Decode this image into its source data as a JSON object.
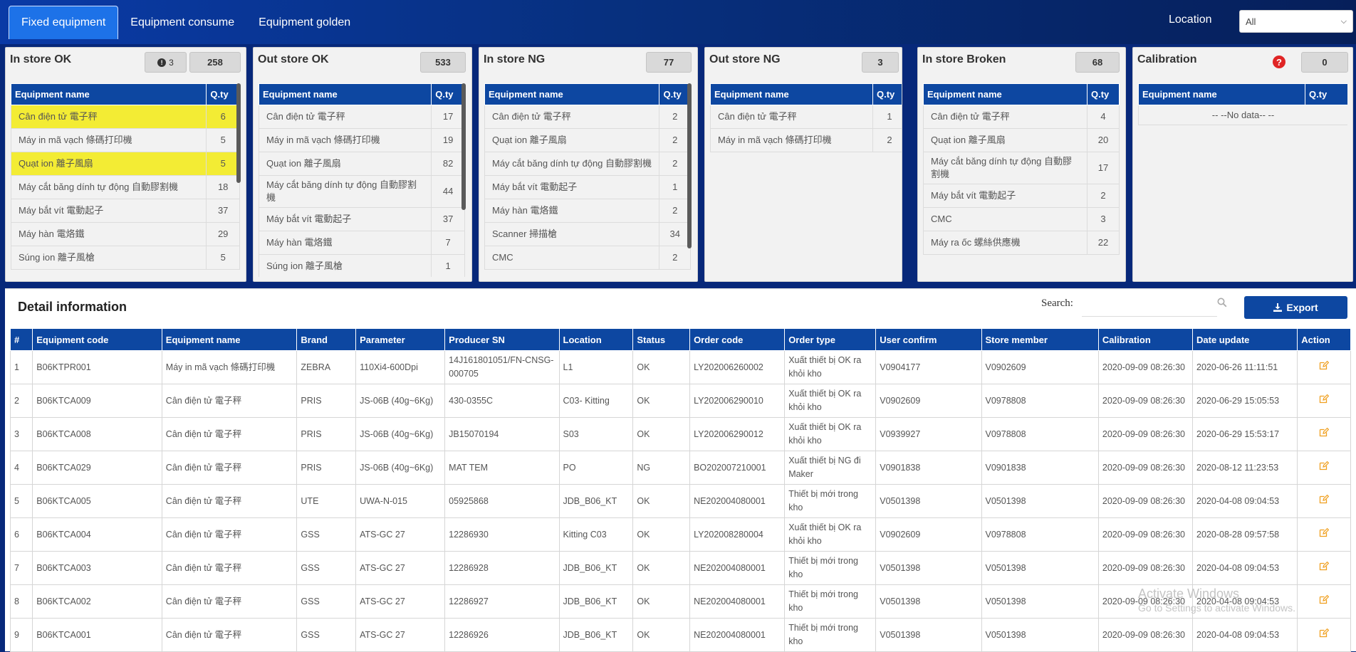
{
  "nav": {
    "tabs": [
      {
        "label": "Fixed equipment",
        "active": true
      },
      {
        "label": "Equipment consume",
        "active": false
      },
      {
        "label": "Equipment golden",
        "active": false
      }
    ],
    "location_label": "Location",
    "location_value": "All"
  },
  "panels": {
    "in_store_ok": {
      "title": "In store OK",
      "warn_count": "3",
      "count": "258",
      "col_name": "Equipment name",
      "col_qty": "Q.ty",
      "rows": [
        {
          "name": "Cân điện tử 電子秤",
          "qty": "6"
        },
        {
          "name": "Máy in mã vạch 條碼打印機",
          "qty": "5"
        },
        {
          "name": "Quạt ion 離子風扇",
          "qty": "5"
        },
        {
          "name": "Máy cắt băng dính tự động 自動膠割機",
          "qty": "18"
        },
        {
          "name": "Máy bắt vít 電動起子",
          "qty": "37"
        },
        {
          "name": "Máy hàn 電烙鐵",
          "qty": "29"
        },
        {
          "name": "Súng ion 離子風槍",
          "qty": "5"
        }
      ],
      "highlight_rows": [
        0,
        2
      ],
      "highlight_color": "#f3ec34"
    },
    "out_store_ok": {
      "title": "Out store OK",
      "count": "533",
      "col_name": "Equipment name",
      "col_qty": "Q.ty",
      "rows": [
        {
          "name": "Cân điện tử 電子秤",
          "qty": "17"
        },
        {
          "name": "Máy in mã vạch 條碼打印機",
          "qty": "19"
        },
        {
          "name": "Quạt ion 離子風扇",
          "qty": "82"
        },
        {
          "name": "Máy cắt băng dính tự động 自動膠割機",
          "qty": "44"
        },
        {
          "name": "Máy bắt vít 電動起子",
          "qty": "37"
        },
        {
          "name": "Máy hàn 電烙鐵",
          "qty": "7"
        },
        {
          "name": "Súng ion 離子風槍",
          "qty": "1"
        }
      ]
    },
    "in_store_ng": {
      "title": "In store NG",
      "count": "77",
      "col_name": "Equipment name",
      "col_qty": "Q.ty",
      "rows": [
        {
          "name": "Cân điện tử 電子秤",
          "qty": "2"
        },
        {
          "name": "Quạt ion 離子風扇",
          "qty": "2"
        },
        {
          "name": "Máy cắt băng dính tự động 自動膠割機",
          "qty": "2"
        },
        {
          "name": "Máy bắt vít 電動起子",
          "qty": "1"
        },
        {
          "name": "Máy hàn 電烙鐵",
          "qty": "2"
        },
        {
          "name": "Scanner 掃描槍",
          "qty": "34"
        },
        {
          "name": "CMC",
          "qty": "2"
        }
      ]
    },
    "out_store_ng": {
      "title": "Out store NG",
      "count": "3",
      "col_name": "Equipment name",
      "col_qty": "Q.ty",
      "rows": [
        {
          "name": "Cân điện tử 電子秤",
          "qty": "1"
        },
        {
          "name": "Máy in mã vạch 條碼打印機",
          "qty": "2"
        }
      ]
    },
    "in_store_broken": {
      "title": "In store Broken",
      "count": "68",
      "col_name": "Equipment name",
      "col_qty": "Q.ty",
      "rows": [
        {
          "name": "Cân điện tử 電子秤",
          "qty": "4"
        },
        {
          "name": "Quạt ion 離子風扇",
          "qty": "20"
        },
        {
          "name": "Máy cắt băng dính tự động 自動膠割機",
          "qty": "17"
        },
        {
          "name": "Máy bắt vít 電動起子",
          "qty": "2"
        },
        {
          "name": "CMC",
          "qty": "3"
        },
        {
          "name": "Máy ra ốc 螺絲供應機",
          "qty": "22"
        }
      ]
    },
    "calibration": {
      "title": "Calibration",
      "alert_icon": "?",
      "count": "0",
      "col_name": "Equipment name",
      "col_qty": "Q.ty",
      "no_data": "-- --No data-- --"
    }
  },
  "detail": {
    "title": "Detail information",
    "search_label": "Search:",
    "search_value": "",
    "export_label": "Export",
    "columns": [
      "#",
      "Equipment code",
      "Equipment name",
      "Brand",
      "Parameter",
      "Producer SN",
      "Location",
      "Status",
      "Order code",
      "Order type",
      "User confirm",
      "Store member",
      "Calibration",
      "Date update",
      "Action"
    ],
    "rows": [
      {
        "no": "1",
        "code": "B06KTPR001",
        "name": "Máy in mã vạch 條碼打印機",
        "brand": "ZEBRA",
        "param": "110Xi4-600Dpi",
        "sn": "14J161801051/FN-CNSG-000705",
        "location": "L1",
        "status": "OK",
        "order_code": "LY202006260002",
        "order_type": "Xuất thiết bị OK ra khỏi kho",
        "user_confirm": "V0904177",
        "store_member": "V0902609",
        "calibration": "2020-09-09 08:26:30",
        "date_update": "2020-06-26 11:11:51"
      },
      {
        "no": "2",
        "code": "B06KTCA009",
        "name": "Cân điện tử 電子秤",
        "brand": "PRIS",
        "param": "JS-06B (40g~6Kg)",
        "sn": "430-0355C",
        "location": "C03- Kitting",
        "status": "OK",
        "order_code": "LY202006290010",
        "order_type": "Xuất thiết bị OK ra khỏi kho",
        "user_confirm": "V0902609",
        "store_member": "V0978808",
        "calibration": "2020-09-09 08:26:30",
        "date_update": "2020-06-29 15:05:53"
      },
      {
        "no": "3",
        "code": "B06KTCA008",
        "name": "Cân điện tử 電子秤",
        "brand": "PRIS",
        "param": "JS-06B (40g~6Kg)",
        "sn": "JB15070194",
        "location": "S03",
        "status": "OK",
        "order_code": "LY202006290012",
        "order_type": "Xuất thiết bị OK ra khỏi kho",
        "user_confirm": "V0939927",
        "store_member": "V0978808",
        "calibration": "2020-09-09 08:26:30",
        "date_update": "2020-06-29 15:53:17"
      },
      {
        "no": "4",
        "code": "B06KTCA029",
        "name": "Cân điện tử 電子秤",
        "brand": "PRIS",
        "param": "JS-06B (40g~6Kg)",
        "sn": "MAT TEM",
        "location": "PO",
        "status": "NG",
        "order_code": "BO202007210001",
        "order_type": "Xuất thiết bị NG đi Maker",
        "user_confirm": "V0901838",
        "store_member": "V0901838",
        "calibration": "2020-09-09 08:26:30",
        "date_update": "2020-08-12 11:23:53"
      },
      {
        "no": "5",
        "code": "B06KTCA005",
        "name": "Cân điện tử 電子秤",
        "brand": "UTE",
        "param": "UWA-N-015",
        "sn": "05925868",
        "location": "JDB_B06_KT",
        "status": "OK",
        "order_code": "NE202004080001",
        "order_type": "Thiết bị mới trong kho",
        "user_confirm": "V0501398",
        "store_member": "V0501398",
        "calibration": "2020-09-09 08:26:30",
        "date_update": "2020-04-08 09:04:53"
      },
      {
        "no": "6",
        "code": "B06KTCA004",
        "name": "Cân điện tử 電子秤",
        "brand": "GSS",
        "param": "ATS-GC 27",
        "sn": "12286930",
        "location": "Kitting C03",
        "status": "OK",
        "order_code": "LY202008280004",
        "order_type": "Xuất thiết bị OK ra khỏi kho",
        "user_confirm": "V0902609",
        "store_member": "V0978808",
        "calibration": "2020-09-09 08:26:30",
        "date_update": "2020-08-28 09:57:58"
      },
      {
        "no": "7",
        "code": "B06KTCA003",
        "name": "Cân điện tử 電子秤",
        "brand": "GSS",
        "param": "ATS-GC 27",
        "sn": "12286928",
        "location": "JDB_B06_KT",
        "status": "OK",
        "order_code": "NE202004080001",
        "order_type": "Thiết bị mới trong kho",
        "user_confirm": "V0501398",
        "store_member": "V0501398",
        "calibration": "2020-09-09 08:26:30",
        "date_update": "2020-04-08 09:04:53"
      },
      {
        "no": "8",
        "code": "B06KTCA002",
        "name": "Cân điện tử 電子秤",
        "brand": "GSS",
        "param": "ATS-GC 27",
        "sn": "12286927",
        "location": "JDB_B06_KT",
        "status": "OK",
        "order_code": "NE202004080001",
        "order_type": "Thiết bị mới trong kho",
        "user_confirm": "V0501398",
        "store_member": "V0501398",
        "calibration": "2020-09-09 08:26:30",
        "date_update": "2020-04-08 09:04:53"
      },
      {
        "no": "9",
        "code": "B06KTCA001",
        "name": "Cân điện tử 電子秤",
        "brand": "GSS",
        "param": "ATS-GC 27",
        "sn": "12286926",
        "location": "JDB_B06_KT",
        "status": "OK",
        "order_code": "NE202004080001",
        "order_type": "Thiết bị mới trong kho",
        "user_confirm": "V0501398",
        "store_member": "V0501398",
        "calibration": "2020-09-09 08:26:30",
        "date_update": "2020-04-08 09:04:53"
      }
    ],
    "action_icon": "edit-icon",
    "action_color": "#f0a020"
  },
  "watermark": {
    "line1": "Activate Windows",
    "line2": "Go to Settings to activate Windows."
  },
  "colors": {
    "header_blue": "#0d47a1",
    "nav_bg": "#07307f",
    "active_tab": "#1d72e8",
    "calibration_alert": "#e02525"
  }
}
